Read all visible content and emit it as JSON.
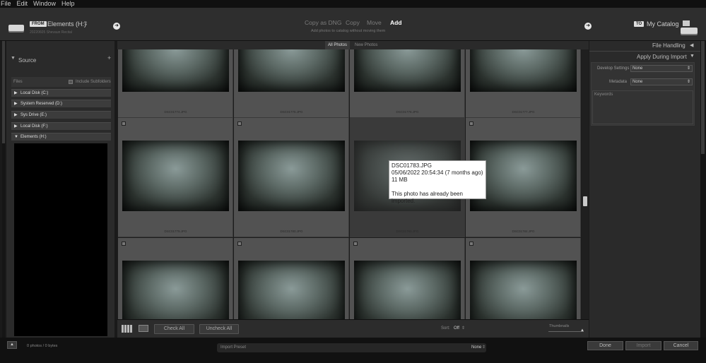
{
  "menu": [
    "File",
    "Edit",
    "Window",
    "Help"
  ],
  "header": {
    "from_tag": "FROM",
    "source_name": "Elements (H:)",
    "source_sub": "20220605 Shevaun Recital",
    "modes": [
      "Copy as DNG",
      "Copy",
      "Move",
      "Add"
    ],
    "mode_active": "Add",
    "mode_desc": "Add photos to catalog without moving them",
    "to_tag": "TO",
    "dest_name": "My Catalog"
  },
  "source_panel": {
    "title": "Source",
    "files_label": "Files",
    "include_subfolders": "Include Subfolders",
    "volumes": [
      "Local Disk (C:)",
      "System Reserved (D:)",
      "Sys Drive (E:)",
      "Local Disk (F:)",
      "Elements (H:)"
    ]
  },
  "tabs": [
    "All Photos",
    "New Photos"
  ],
  "grid": {
    "rows": [
      [
        "DSC01774.JPG",
        "DSC01775.JPG",
        "DSC01776.JPG",
        "DSC01777.JPG"
      ],
      [
        "DSC01779.JPG",
        "DSC01780.JPG",
        "DSC01783.JPG",
        "DSC01784.JPG"
      ],
      [
        "",
        "",
        "",
        ""
      ]
    ]
  },
  "tooltip": {
    "filename": "DSC01783.JPG",
    "date": "05/06/2022 20:54:34 (7 months ago)",
    "size": "11 MB",
    "note": "This photo has already been imported."
  },
  "grid_toolbar": {
    "check_all": "Check All",
    "uncheck_all": "Uncheck All",
    "sort_label": "Sort:",
    "sort_value": "Off",
    "thumbnails_label": "Thumbnails"
  },
  "right_panel": {
    "file_handling": "File Handling",
    "apply_during_import": "Apply During Import",
    "develop_settings_label": "Develop Settings",
    "develop_settings_value": "None",
    "metadata_label": "Metadata",
    "metadata_value": "None",
    "keywords_label": "Keywords"
  },
  "bottom": {
    "count": "0 photos / 0 bytes",
    "import_preset_label": "Import Preset",
    "import_preset_value": "None",
    "done": "Done",
    "import": "Import",
    "cancel": "Cancel"
  },
  "colors": {
    "background": "#1a1a1a",
    "panel": "#2a2a2a",
    "cell": "#525252",
    "accent_text": "#ffffff"
  }
}
